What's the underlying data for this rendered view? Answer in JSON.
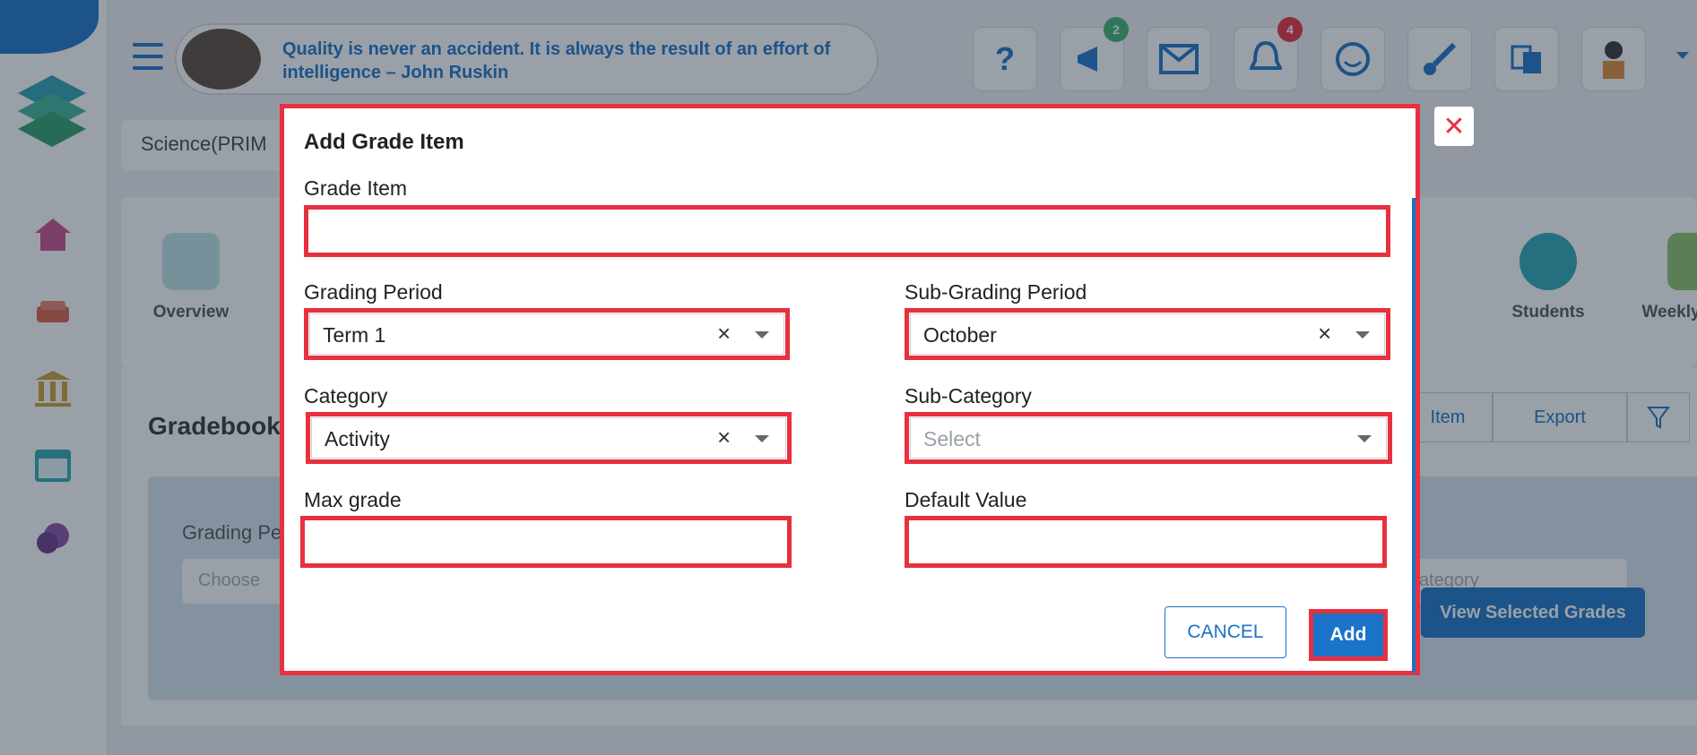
{
  "header": {
    "quote": "Quality is never an accident. It is always the result of an effort of intelligence – John Ruskin",
    "badges": {
      "announcements": "2",
      "notifications": "4"
    },
    "breadcrumb": "Science(PRIM"
  },
  "tabs": {
    "overview": "Overview",
    "students": "Students",
    "weekly_plans": "Weekly Plans"
  },
  "gradebook": {
    "title": "Gradebook",
    "filter_label": "Grading Pe",
    "choose_placeholder": "Choose",
    "category_placeholder": "ategory",
    "item_button": "Item",
    "export_button": "Export",
    "view_selected": "View Selected Grades"
  },
  "modal": {
    "title": "Add Grade Item",
    "grade_item": {
      "label": "Grade Item",
      "value": ""
    },
    "grading_period": {
      "label": "Grading Period",
      "value": "Term 1"
    },
    "sub_grading_period": {
      "label": "Sub-Grading Period",
      "value": "October"
    },
    "category": {
      "label": "Category",
      "value": "Activity"
    },
    "sub_category": {
      "label": "Sub-Category",
      "placeholder": "Select"
    },
    "max_grade": {
      "label": "Max grade",
      "value": ""
    },
    "default_value": {
      "label": "Default Value",
      "value": ""
    },
    "cancel_label": "CANCEL",
    "add_label": "Add",
    "close_symbol": "✕",
    "clear_symbol": "×"
  },
  "colors": {
    "accent": "#1a73c8",
    "highlight": "#e8303e"
  }
}
